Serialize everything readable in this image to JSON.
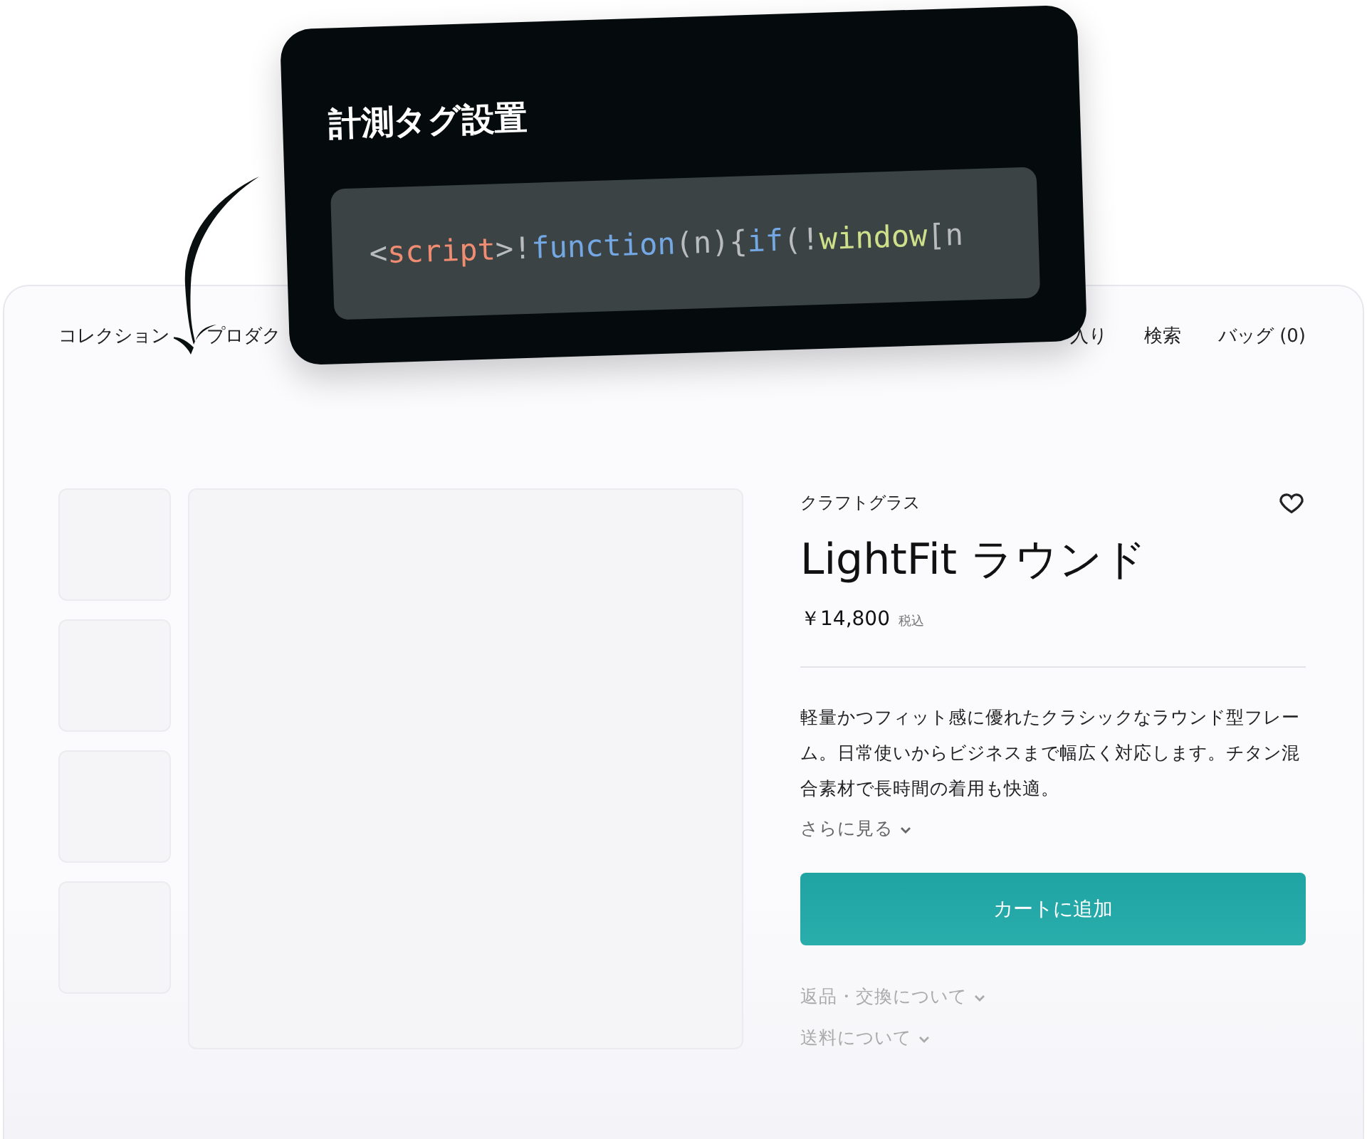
{
  "overlay": {
    "title": "計測タグ設置",
    "code": [
      {
        "text": "<",
        "kind": "punct"
      },
      {
        "text": "script",
        "kind": "tag"
      },
      {
        "text": ">!",
        "kind": "punct"
      },
      {
        "text": "function",
        "kind": "keyword"
      },
      {
        "text": "(n){",
        "kind": "punct"
      },
      {
        "text": "if",
        "kind": "keyword"
      },
      {
        "text": "(!",
        "kind": "punct"
      },
      {
        "text": "window",
        "kind": "global"
      },
      {
        "text": "[n",
        "kind": "punct"
      }
    ]
  },
  "nav": {
    "left": [
      "コレクション",
      "プロダク"
    ],
    "right": [
      "入り",
      "検索",
      "バッグ (0)"
    ]
  },
  "product": {
    "brand": "クラフトグラス",
    "name": "LightFit ラウンド",
    "favorite": false,
    "price": "￥14,800",
    "tax_note": "税込",
    "description": "軽量かつフィット感に優れたクラシックなラウンド型フレーム。日常使いからビジネスまで幅広く対応します。チタン混合素材で長時間の着用も快適。",
    "more_link": "さらに見る",
    "cart_button": "カートに追加",
    "sections": [
      {
        "label": "返品・交換について",
        "expanded": false
      },
      {
        "label": "送料について",
        "expanded": false
      }
    ]
  }
}
